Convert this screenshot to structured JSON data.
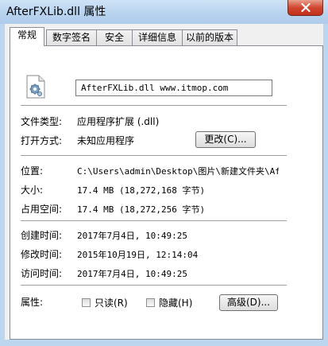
{
  "window": {
    "title": "AfterFXLib.dll 属性"
  },
  "tabs": [
    {
      "label": "常规",
      "active": true
    },
    {
      "label": "数字签名",
      "active": false
    },
    {
      "label": "安全",
      "active": false
    },
    {
      "label": "详细信息",
      "active": false
    },
    {
      "label": "以前的版本",
      "active": false
    }
  ],
  "general": {
    "file_icon": "dll-settings-file-icon",
    "file_name": "AfterFXLib.dll www.itmop.com",
    "file_type_label": "文件类型:",
    "file_type_value": "应用程序扩展 (.dll)",
    "opens_with_label": "打开方式:",
    "opens_with_value": "未知应用程序",
    "change_button": "更改(C)...",
    "location_label": "位置:",
    "location_value": "C:\\Users\\admin\\Desktop\\图片\\新建文件夹\\Af",
    "size_label": "大小:",
    "size_value": "17.4 MB (18,272,168 字节)",
    "size_on_disk_label": "占用空间:",
    "size_on_disk_value": "17.4 MB (18,272,256 字节)",
    "created_label": "创建时间:",
    "created_value": "2017年7月4日, 10:49:25",
    "modified_label": "修改时间:",
    "modified_value": "2015年10月19日, 12:14:04",
    "accessed_label": "访问时间:",
    "accessed_value": "2017年7月4日, 10:49:25",
    "attributes_label": "属性:",
    "readonly_label": "只读(R)",
    "readonly_checked": false,
    "hidden_label": "隐藏(H)",
    "hidden_checked": false,
    "advanced_button": "高级(D)..."
  },
  "colors": {
    "close_button": "#c7402a",
    "titlebar": "#b9d4ef",
    "panel_bg": "#f0f0f0"
  }
}
